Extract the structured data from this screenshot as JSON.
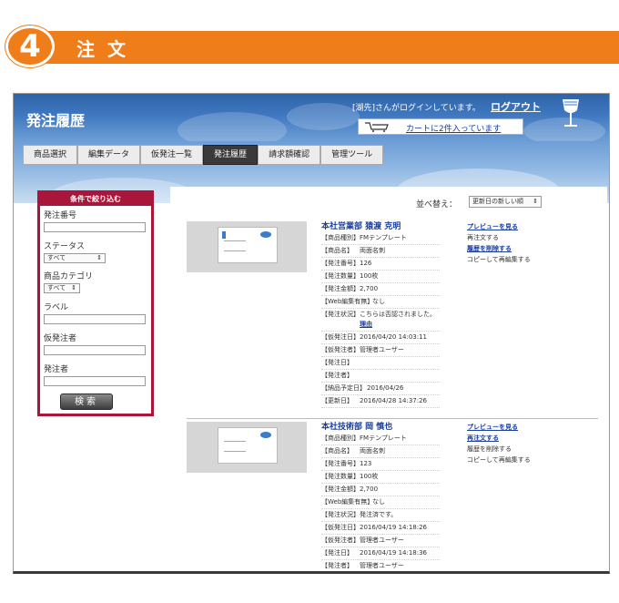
{
  "step": {
    "number": "4",
    "title": "注文",
    "color": "#ee7d1a"
  },
  "app": {
    "title": "発注履歴",
    "login_status": "[湖先]さんがログインしています。",
    "logout_label": "ログアウト",
    "cart_text": "カートに2件入っています",
    "icons": [
      "cart-icon",
      "glass-icon"
    ]
  },
  "nav": {
    "items": [
      {
        "label": "商品選択"
      },
      {
        "label": "編集データ"
      },
      {
        "label": "仮発注一覧"
      },
      {
        "label": "発注履歴",
        "active": true
      },
      {
        "label": "請求額確認"
      },
      {
        "label": "管理ツール"
      }
    ]
  },
  "sidebar": {
    "heading": "条件で絞り込む",
    "order_number_label": "発注番号",
    "status_label": "ステータス",
    "status_value": "すべて",
    "category_label": "商品カテゴリ",
    "category_value": "すべて",
    "label_label": "ラベル",
    "provisional_orderer_label": "仮発注者",
    "orderer_label": "発注者",
    "search_button": "検索",
    "accent_color": "#a8173a"
  },
  "sort": {
    "label": "並べ替え：",
    "value": "更新日の新しい順"
  },
  "orders": [
    {
      "title": "本社営業部 猿渡 克明",
      "type_label": "【商品種別】",
      "type_value": "FMテンプレート",
      "name_label": "【商品名】",
      "name_value": "両面名刺",
      "number_label": "【発注番号】",
      "number_value": "126",
      "quantity_label": "【発注数量】",
      "quantity_value": "100枚",
      "amount_label": "【発注金額】",
      "amount_value": "2,700",
      "web_label": "【Web編集有無】",
      "web_value": "なし",
      "status_label": "【発注状況】",
      "status_value": "こちらは否認されました。",
      "reason_link": "理由",
      "prov_date_label": "【仮発注日】",
      "prov_date_value": "2016/04/20 14:03:11",
      "prov_person_label": "【仮発注者】",
      "prov_person_value": "管理者ユーザー",
      "order_date_label": "【発注日】",
      "order_date_value": "",
      "orderer_label": "【発注者】",
      "orderer_value": "",
      "delivery_label": "【納品予定日】",
      "delivery_value": "2016/04/26",
      "updated_label": "【更新日】",
      "updated_value": "2016/04/28 14:37:26",
      "actions": [
        "プレビューを見る",
        "再注文する",
        "履歴を削除する",
        "コピーして再編集する"
      ]
    },
    {
      "title": "本社技術部 岡 慎也",
      "type_label": "【商品種別】",
      "type_value": "FMテンプレート",
      "name_label": "【商品名】",
      "name_value": "両面名刺",
      "number_label": "【発注番号】",
      "number_value": "123",
      "quantity_label": "【発注数量】",
      "quantity_value": "100枚",
      "amount_label": "【発注金額】",
      "amount_value": "2,700",
      "web_label": "【Web編集有無】",
      "web_value": "なし",
      "status_label": "【発注状況】",
      "status_value": "発注済です。",
      "prov_date_label": "【仮発注日】",
      "prov_date_value": "2016/04/19 14:18:26",
      "prov_person_label": "【仮発注者】",
      "prov_person_value": "管理者ユーザー",
      "order_date_label": "【発注日】",
      "order_date_value": "2016/04/19 14:18:36",
      "orderer_label": "【発注者】",
      "orderer_value": "管理者ユーザー",
      "actions": [
        "プレビューを見る",
        "再注文する",
        "履歴を削除する",
        "コピーして再編集する"
      ]
    }
  ]
}
